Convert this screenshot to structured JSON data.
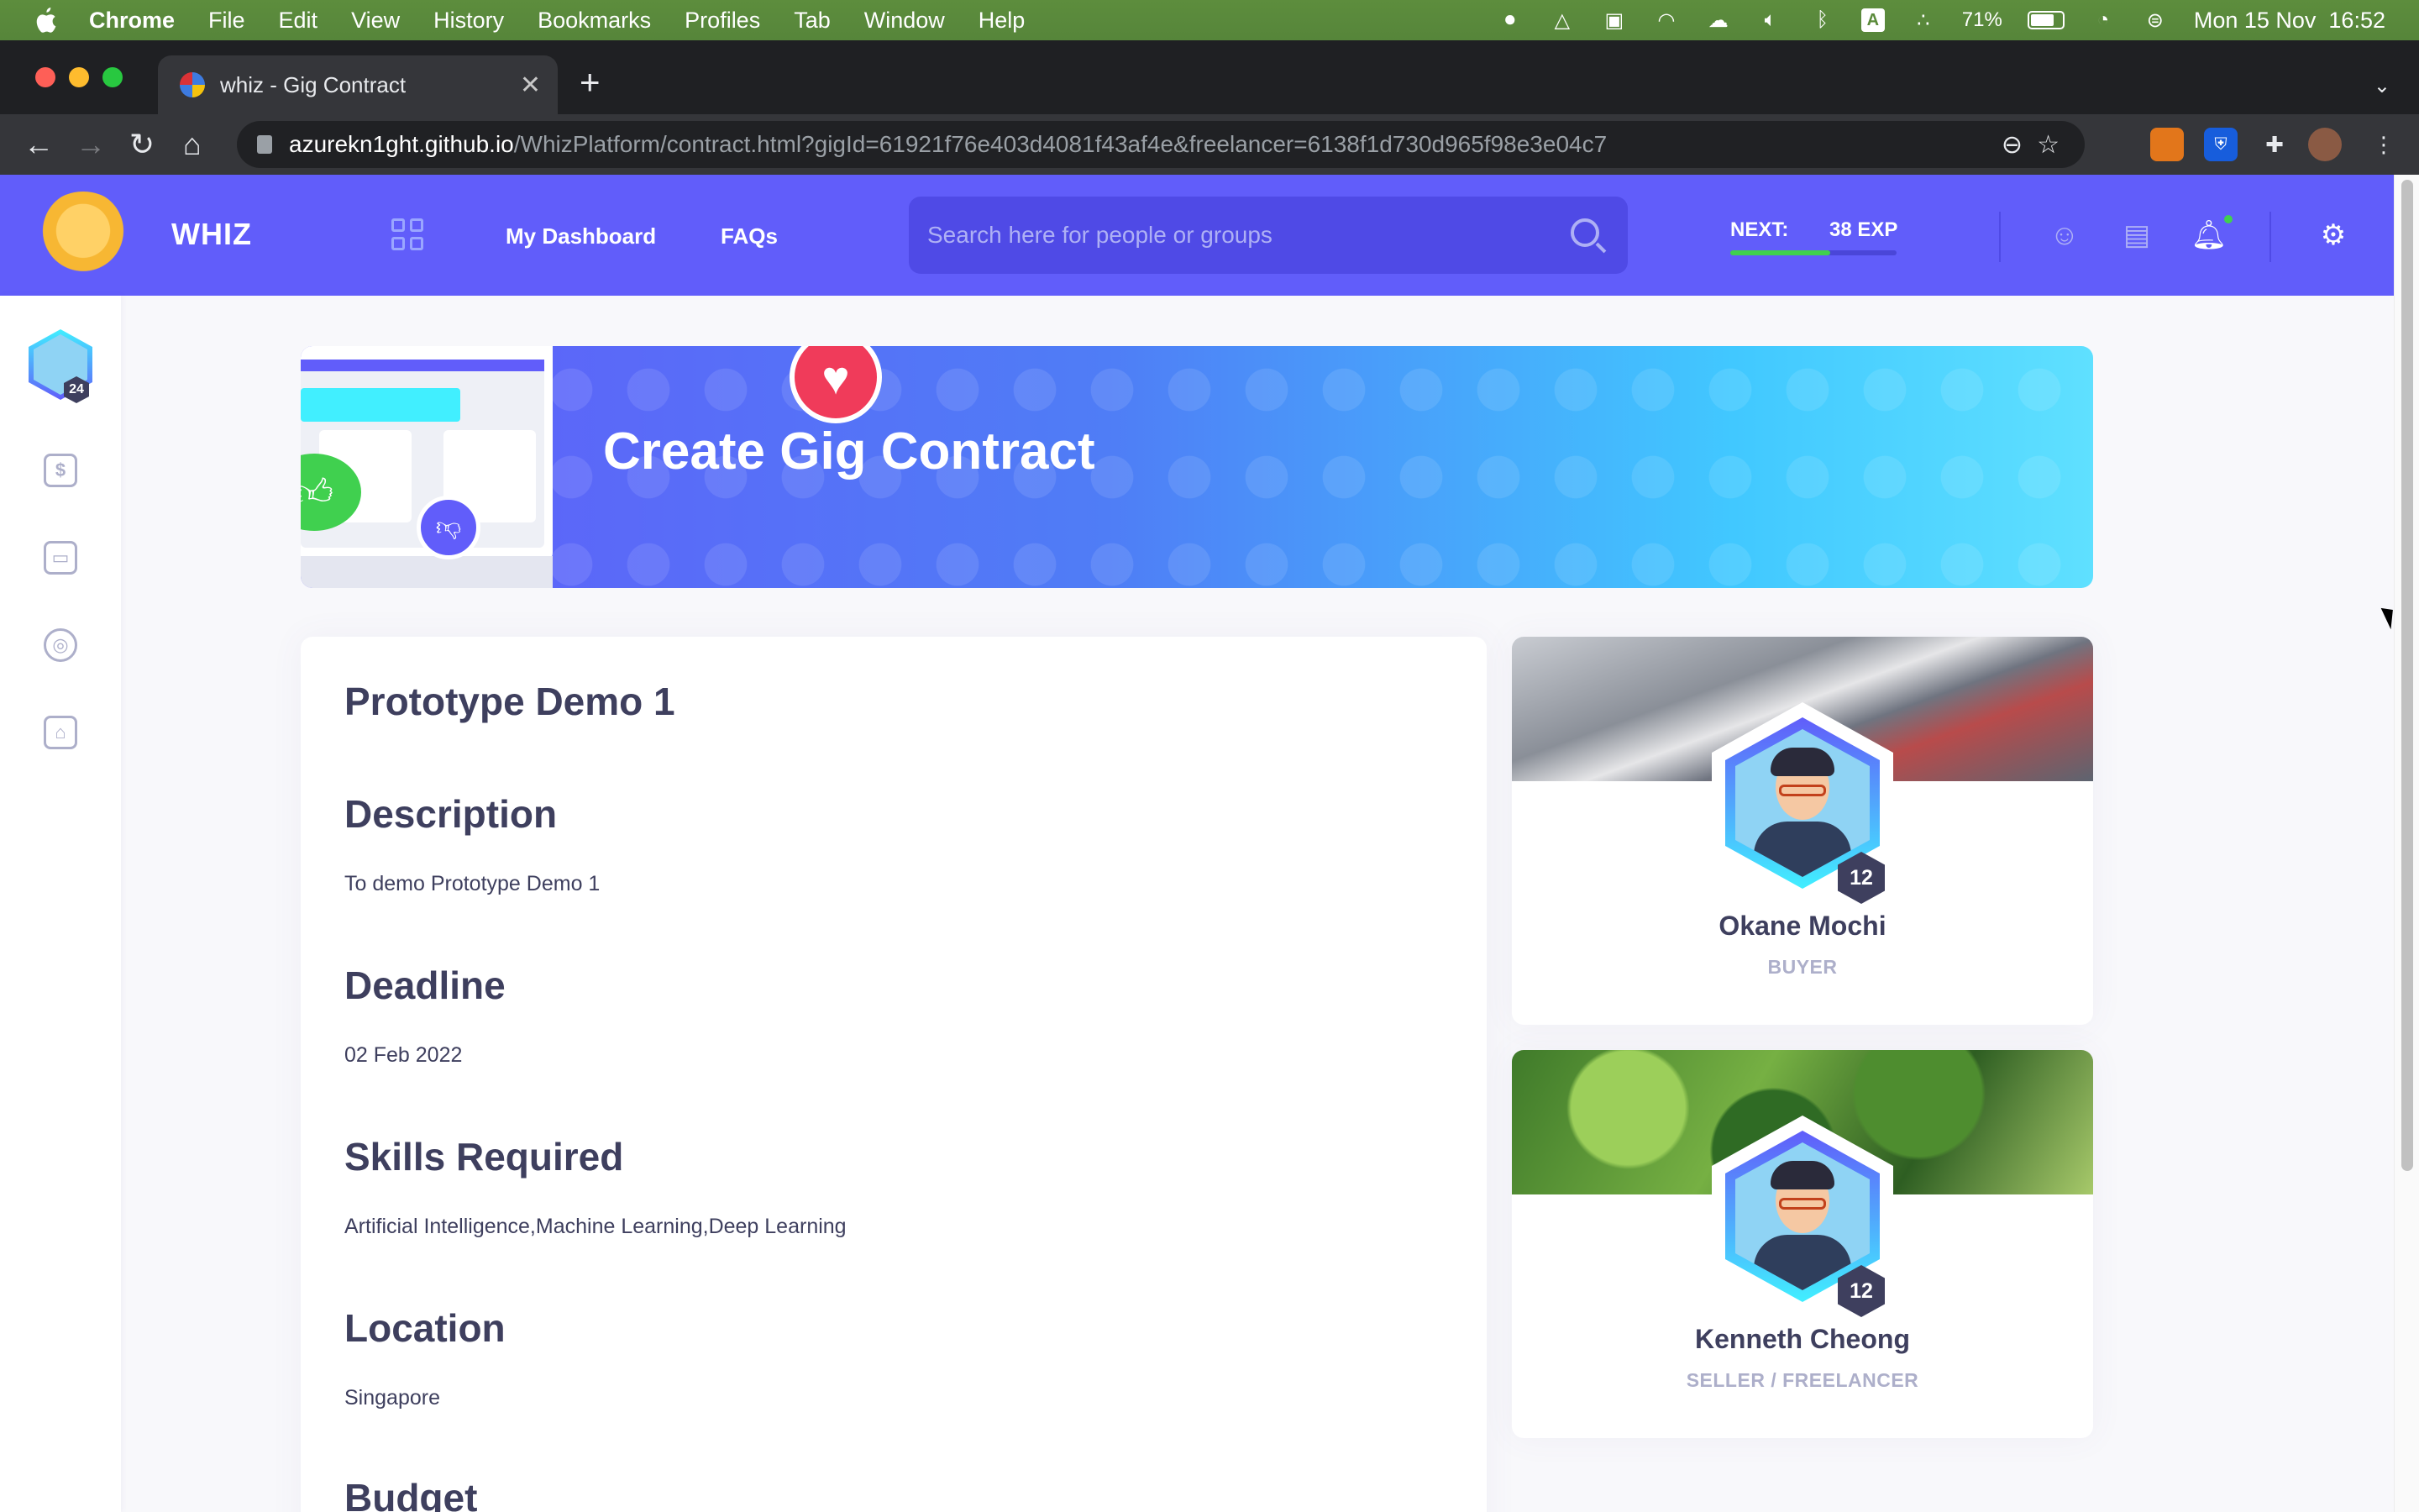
{
  "macos": {
    "app_name": "Chrome",
    "menus": [
      "File",
      "Edit",
      "View",
      "History",
      "Bookmarks",
      "Profiles",
      "Tab",
      "Window",
      "Help"
    ],
    "status": {
      "battery": "71%",
      "datetime": "Mon 15 Nov  16:52",
      "input_source": "A"
    }
  },
  "browser": {
    "tab_title": "whiz - Gig Contract",
    "url_host": "azurekn1ght.github.io",
    "url_path": "/WhizPlatform/contract.html?gigId=61921f76e403d4081f43af4e&freelancer=6138f1d730d965f98e3e04c7"
  },
  "header": {
    "brand": "WHIZ",
    "nav": {
      "dashboard": "My Dashboard",
      "faqs": "FAQs"
    },
    "search_placeholder": "Search here for people or groups",
    "exp": {
      "label": "NEXT:",
      "value": "38 EXP",
      "progress": 0.6
    }
  },
  "sidebar": {
    "avatar_level": "24"
  },
  "banner": {
    "title": "Create Gig Contract"
  },
  "gig": {
    "name": "Prototype Demo 1",
    "sections": [
      {
        "title": "Description",
        "value": "To demo Prototype Demo 1"
      },
      {
        "title": "Deadline",
        "value": "02 Feb 2022"
      },
      {
        "title": "Skills Required",
        "value": "Artificial Intelligence,Machine Learning,Deep Learning"
      },
      {
        "title": "Location",
        "value": "Singapore"
      },
      {
        "title": "Budget",
        "value": ""
      }
    ]
  },
  "buyer": {
    "name": "Okane Mochi",
    "role": "BUYER",
    "level": "12"
  },
  "seller": {
    "name": "Kenneth Cheong",
    "role": "SELLER / FREELANCER",
    "level": "12"
  },
  "colors": {
    "primary": "#615dfa",
    "accent": "#41efff",
    "dark_text": "#3e3f5e",
    "muted_text": "#adafca",
    "heart": "#f03b5a",
    "green": "#40d04f"
  }
}
